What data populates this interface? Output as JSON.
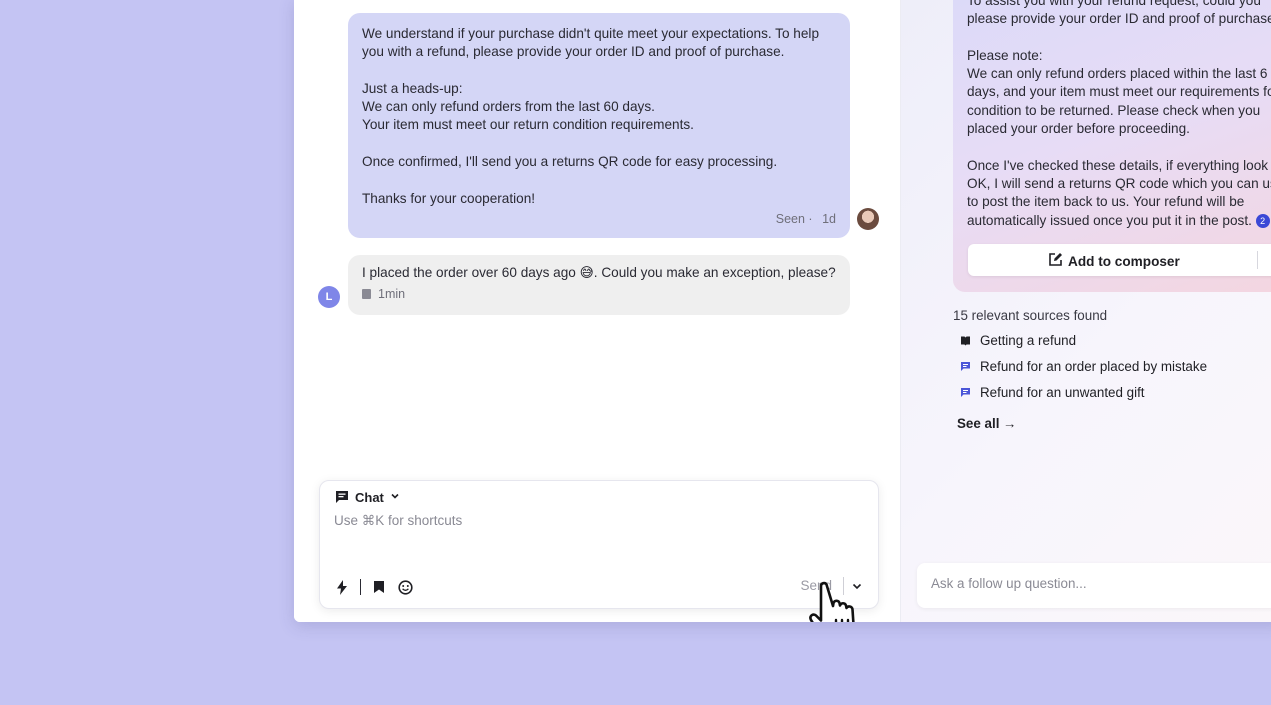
{
  "conversation": {
    "agent_message": {
      "lines": [
        "We understand if your purchase didn't quite meet your expectations. To help",
        "you with a refund, please provide your order ID and proof of purchase.",
        "",
        "Just a heads-up:",
        "We can only refund orders from the last 60 days.",
        "Your item must meet our return condition requirements.",
        "",
        "Once confirmed, I'll send you a returns QR code for easy processing.",
        "",
        "Thanks for your cooperation!"
      ],
      "seen_label": "Seen ·",
      "seen_time": "1d"
    },
    "user_message": {
      "text": "I placed the order over 60 days ago 😅. Could you make an exception, please?",
      "time": "1min",
      "avatar_letter": "L"
    }
  },
  "composer": {
    "channel_label": "Chat",
    "placeholder": "Use ⌘K for shortcuts",
    "send_label": "Send"
  },
  "copilot": {
    "answer_lines": [
      "To assist you with your refund request, could you",
      "please provide your order ID and proof of purchase",
      "",
      "Please note:",
      "We can only refund orders placed within the last 6",
      "days, and your item must meet our requirements fo",
      "condition to be returned. Please check when you",
      "placed your order before proceeding.",
      "",
      "Once I've checked these details, if everything look",
      "OK, I will send a returns QR code which you can us",
      "to post the item back to us. Your refund will be",
      "automatically issued once you put it in the post."
    ],
    "citation_number": "2",
    "add_to_composer_label": "Add to composer",
    "sources_title": "15 relevant sources found",
    "sources": [
      {
        "title": "Getting a refund",
        "icon": "book-icon"
      },
      {
        "title": "Refund for an order placed by mistake",
        "icon": "chat-icon"
      },
      {
        "title": "Refund for an unwanted gift",
        "icon": "chat-icon"
      }
    ],
    "see_all_label": "See all →",
    "followup_placeholder": "Ask a follow up question..."
  },
  "colors": {
    "background": "#c4c4f3",
    "agent_bubble": "#d4d6f6",
    "user_bubble": "#efefef",
    "citation": "#3b48d6"
  }
}
